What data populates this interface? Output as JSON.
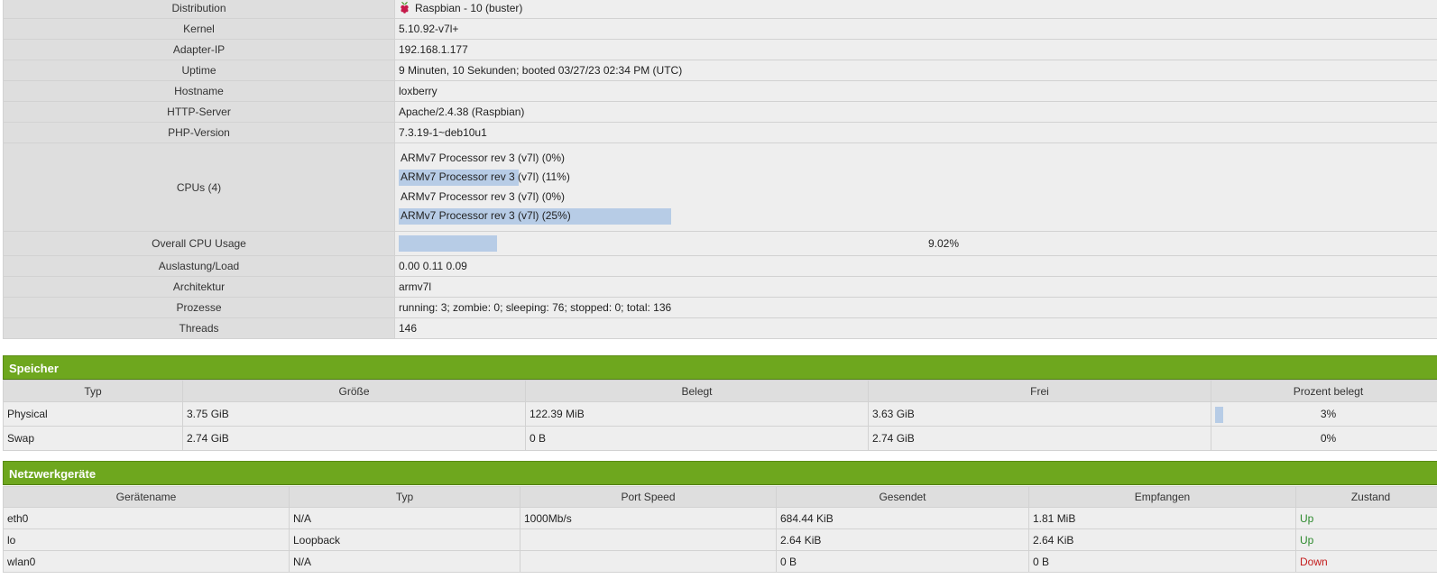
{
  "system": {
    "distribution": {
      "label": "Distribution",
      "value": "Raspbian - 10 (buster)",
      "icon": "raspberry-pi-icon"
    },
    "kernel": {
      "label": "Kernel",
      "value": "5.10.92-v7l+"
    },
    "adapter_ip": {
      "label": "Adapter-IP",
      "value": "192.168.1.177"
    },
    "uptime": {
      "label": "Uptime",
      "value": "9 Minuten, 10 Sekunden; booted 03/27/23 02:34 PM (UTC)"
    },
    "hostname": {
      "label": "Hostname",
      "value": "loxberry"
    },
    "http_server": {
      "label": "HTTP-Server",
      "value": "Apache/2.4.38 (Raspbian)"
    },
    "php_version": {
      "label": "PHP-Version",
      "value": "7.3.19-1~deb10u1"
    },
    "cpus": {
      "label": "CPUs (4)",
      "items": [
        {
          "name": "ARMv7 Processor rev 3 (v7l) (0%)",
          "usage": 0
        },
        {
          "name": "ARMv7 Processor rev 3 (v7l) (11%)",
          "usage": 11
        },
        {
          "name": "ARMv7 Processor rev 3 (v7l) (0%)",
          "usage": 0
        },
        {
          "name": "ARMv7 Processor rev 3 (v7l) (25%)",
          "usage": 25
        }
      ]
    },
    "overall_cpu": {
      "label": "Overall CPU Usage",
      "value": "9.02%"
    },
    "load": {
      "label": "Auslastung/Load",
      "value": "0.00 0.11 0.09"
    },
    "architecture": {
      "label": "Architektur",
      "value": "armv7l"
    },
    "processes": {
      "label": "Prozesse",
      "value": "running: 3; zombie: 0; sleeping: 76; stopped: 0; total: 136"
    },
    "threads": {
      "label": "Threads",
      "value": "146"
    }
  },
  "memory": {
    "title": "Speicher",
    "headers": [
      "Typ",
      "Größe",
      "Belegt",
      "Frei",
      "Prozent belegt"
    ],
    "rows": [
      {
        "type": "Physical",
        "size": "3.75 GiB",
        "used": "122.39 MiB",
        "free": "3.63 GiB",
        "percent": "3%",
        "percent_value": 3
      },
      {
        "type": "Swap",
        "size": "2.74 GiB",
        "used": "0 B",
        "free": "2.74 GiB",
        "percent": "0%",
        "percent_value": 0
      }
    ]
  },
  "network": {
    "title": "Netzwerkgeräte",
    "headers": [
      "Gerätename",
      "Typ",
      "Port Speed",
      "Gesendet",
      "Empfangen",
      "Zustand"
    ],
    "rows": [
      {
        "name": "eth0",
        "type": "N/A",
        "speed": "1000Mb/s",
        "sent": "684.44 KiB",
        "received": "1.81 MiB",
        "state": "Up"
      },
      {
        "name": "lo",
        "type": "Loopback",
        "speed": "",
        "sent": "2.64 KiB",
        "received": "2.64 KiB",
        "state": "Up"
      },
      {
        "name": "wlan0",
        "type": "N/A",
        "speed": "",
        "sent": "0 B",
        "received": "0 B",
        "state": "Down"
      }
    ]
  },
  "colors": {
    "section_header": "#6ea71e",
    "usage_bar": "#b7cce6",
    "state_up": "#2d8a2d",
    "state_down": "#c41e1e"
  }
}
